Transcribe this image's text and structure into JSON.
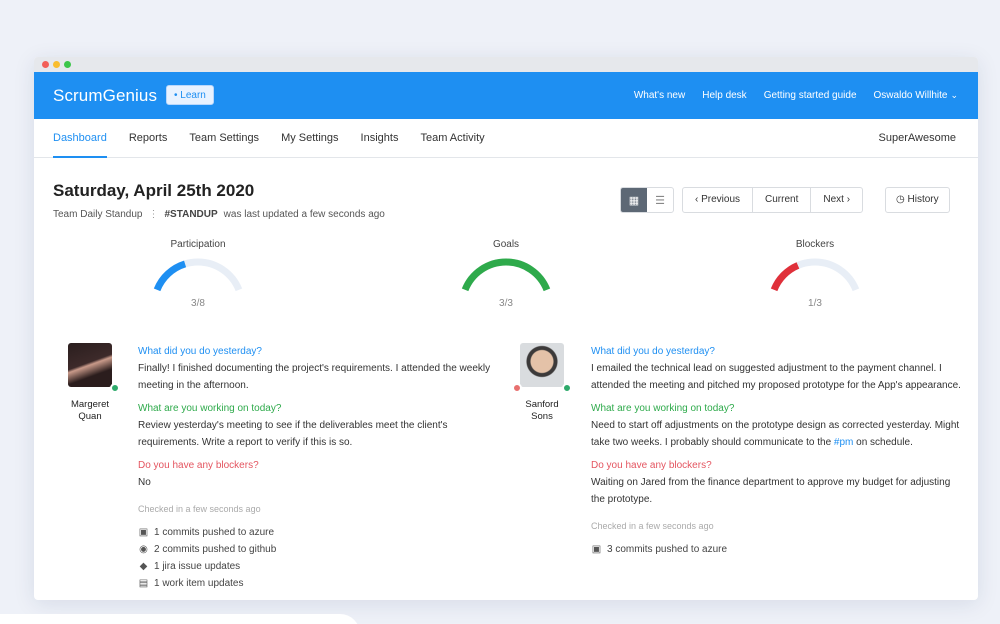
{
  "app": {
    "brand": "ScrumGenius",
    "learn_badge": "• Learn",
    "top_links": [
      "What's new",
      "Help desk",
      "Getting started guide"
    ],
    "user": "Oswaldo Willhite"
  },
  "tabs": [
    "Dashboard",
    "Reports",
    "Team Settings",
    "My Settings",
    "Insights",
    "Team Activity"
  ],
  "active_tab": "Dashboard",
  "tenant": "SuperAwesome",
  "header": {
    "date_title": "Saturday, April 25th 2020",
    "standup_name": "Team Daily Standup",
    "standup_tag": "#STANDUP",
    "updated_text": "was last updated a few seconds ago"
  },
  "controls": {
    "previous": "Previous",
    "current": "Current",
    "next": "Next",
    "history": "History"
  },
  "gauges": [
    {
      "label": "Participation",
      "value_text": "3/8",
      "fraction": 0.375,
      "color": "#1e8ff2"
    },
    {
      "label": "Goals",
      "value_text": "3/3",
      "fraction": 1.0,
      "color": "#2eaa4b"
    },
    {
      "label": "Blockers",
      "value_text": "1/3",
      "fraction": 0.333,
      "color": "#e0303a"
    }
  ],
  "members": [
    {
      "name_line1": "Margeret",
      "name_line2": "Quan",
      "q1": "What did you do yesterday?",
      "a1": "Finally! I finished documenting the project's requirements. I attended the weekly meeting in the afternoon.",
      "q2": "What are you working on today?",
      "a2": "Review yesterday's meeting to see if the deliverables meet the client's requirements. Write a report to verify if this is so.",
      "q3": "Do you have any blockers?",
      "a3": "No",
      "checked": "Checked in a few seconds ago",
      "activity": [
        {
          "icon": "azure-icon",
          "text": "1 commits pushed to azure"
        },
        {
          "icon": "github-icon",
          "text": "2 commits pushed to github"
        },
        {
          "icon": "jira-icon",
          "text": "1 jira issue updates"
        },
        {
          "icon": "work-item-icon",
          "text": "1 work item updates"
        }
      ]
    },
    {
      "name_line1": "Sanford",
      "name_line2": "Sons",
      "q1": "What did you do yesterday?",
      "a1": "I emailed the technical lead on suggested adjustment to the payment channel. I attended the meeting and pitched my proposed prototype for the App's appearance.",
      "q2": "What are you working on today?",
      "a2_pre": "Need to start off adjustments on the prototype design as corrected yesterday. Might take two weeks. I probably should communicate to the ",
      "a2_tag": "#pm",
      "a2_post": " on schedule.",
      "q3": "Do you have any blockers?",
      "a3": "Waiting on Jared from the finance department to approve my budget for adjusting the prototype.",
      "checked": "Checked in a few seconds ago",
      "activity": [
        {
          "icon": "azure-icon",
          "text": "3 commits pushed to azure"
        }
      ]
    }
  ]
}
